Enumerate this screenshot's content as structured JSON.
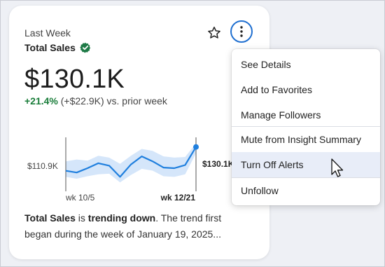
{
  "card": {
    "period": "Last Week",
    "metric_title": "Total Sales",
    "value": "$130.1K",
    "change_pct": "+21.4%",
    "change_detail": "(+$22.9K) vs. prior week",
    "summary": {
      "metric": "Total Sales",
      "is_text": " is ",
      "trend": "trending down",
      "rest": ". The trend first began during the week of January 19, 2025..."
    },
    "icons": {
      "verified": "verified-check-icon",
      "favorite": "star-icon",
      "more": "more-vertical-icon"
    },
    "colors": {
      "accent": "#1f6fd0",
      "positive": "#1a7d3a",
      "verified": "#1e7a46"
    }
  },
  "chart_data": {
    "type": "line",
    "x_labels": [
      "wk 10/5",
      "wk 12/21"
    ],
    "values": [
      110.9,
      109.5,
      113.0,
      117.0,
      115.0,
      106.0,
      116.0,
      122.5,
      118.5,
      113.5,
      113.0,
      115.5,
      130.1
    ],
    "band_upper": [
      118.5,
      120.0,
      119.0,
      123.0,
      121.5,
      116.5,
      123.0,
      128.5,
      127.0,
      122.5,
      121.5,
      122.0,
      133.0
    ],
    "band_lower": [
      106.0,
      104.5,
      106.5,
      108.0,
      108.5,
      101.5,
      107.5,
      112.5,
      111.0,
      106.5,
      106.0,
      108.0,
      125.0
    ],
    "start_label": "$110.9K",
    "end_label": "$130.1K",
    "line_color": "#1f7fde",
    "band_color": "#d5e6fa"
  },
  "menu": {
    "items": [
      {
        "label": "See Details"
      },
      {
        "label": "Add to Favorites"
      },
      {
        "label": "Manage Followers"
      },
      {
        "label": "Mute from Insight Summary"
      },
      {
        "label": "Turn Off Alerts"
      },
      {
        "label": "Unfollow"
      }
    ],
    "hovered_item": "Turn Off Alerts"
  }
}
